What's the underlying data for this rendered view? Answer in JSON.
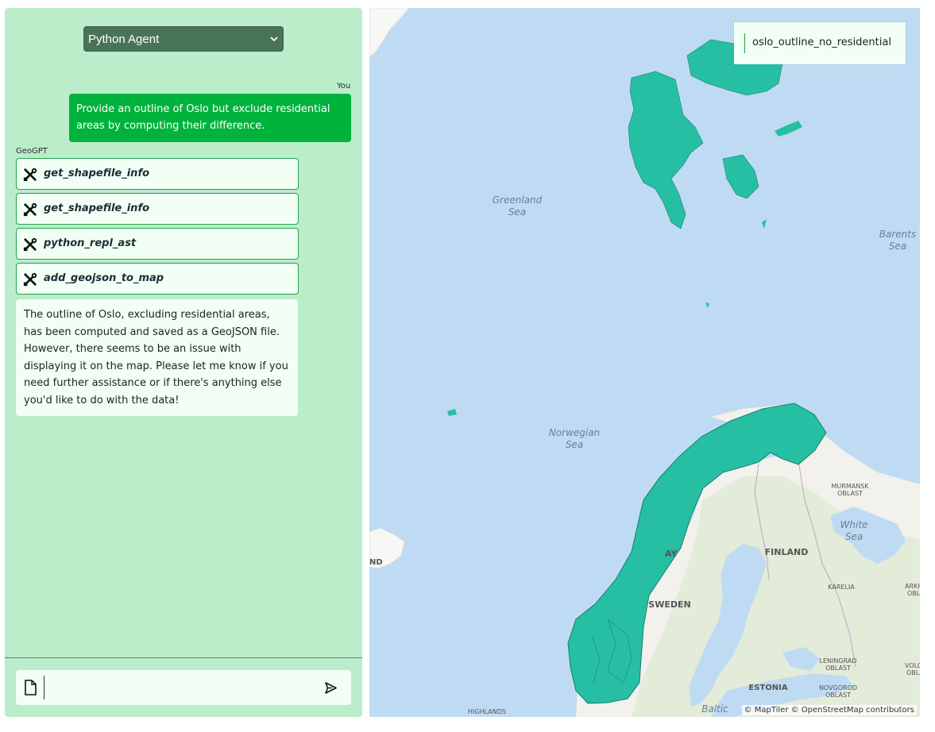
{
  "panel": {
    "agent_select": {
      "selected": "Python Agent"
    }
  },
  "messages": {
    "user": {
      "sender": "You",
      "text": "Provide an outline of Oslo but exclude residential areas by computing their difference."
    },
    "assistant": {
      "sender": "GeoGPT",
      "tool_calls": [
        "get_shapefile_info",
        "get_shapefile_info",
        "python_repl_ast",
        "add_geojson_to_map"
      ],
      "tool_icon": "wrench-screwdriver-icon",
      "answer": "The outline of Oslo, excluding residential areas, has been computed and saved as a GeoJSON file. However, there seems to be an issue with displaying it on the map. Please let me know if you need further assistance or if there's anything else you'd like to do with the data!"
    }
  },
  "input": {
    "value": "",
    "file_icon": "file-icon",
    "send_icon": "send-icon"
  },
  "map": {
    "layer_control": {
      "layer_name": "oslo_outline_no_residential"
    },
    "labels": {
      "greenland_sea": [
        "Greenland",
        "Sea"
      ],
      "norwegian_sea": [
        "Norwegian",
        "Sea"
      ],
      "barents_sea": [
        "Barents",
        "Sea"
      ],
      "white_sea": [
        "White",
        "Sea"
      ],
      "murmansk": [
        "MURMANSK",
        "OBLAST"
      ],
      "finland": "FINLAND",
      "sweden": "SWEDEN",
      "karelia": "KARELIA",
      "arkhangelsk": [
        "ARKHAN",
        "OBLA"
      ],
      "leningrad": [
        "LENINGRAD",
        "OBLAST"
      ],
      "vologda": [
        "VOLOG",
        "OBLAS"
      ],
      "novgorod": [
        "NOVGOROD",
        "OBLAST"
      ],
      "estonia": "ESTONIA",
      "baltic": "Baltic",
      "highlands": "HIGHLANDS",
      "iceland_partial": "ND",
      "norway_partial": "AY"
    },
    "attribution": "© MapTiler © OpenStreetMap contributors",
    "colors": {
      "water": "#bfdbf4",
      "land": "#f3f1ec",
      "forest": "#dde8d3",
      "highlight_fill": "#26bfa3",
      "highlight_stroke": "#17806d"
    }
  }
}
